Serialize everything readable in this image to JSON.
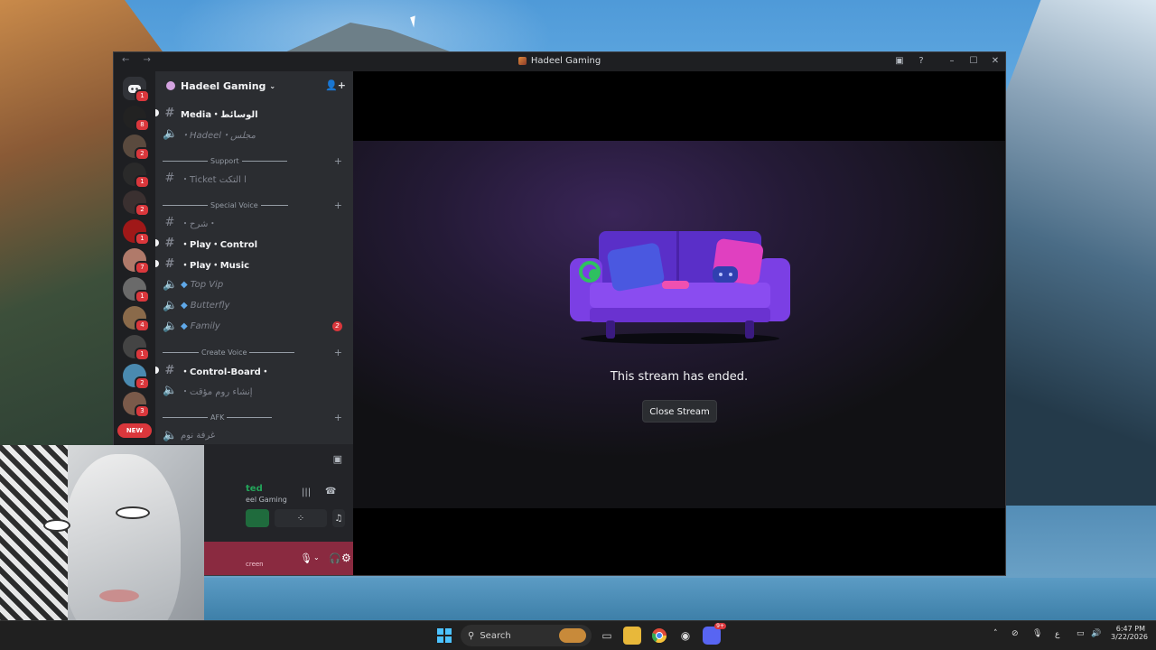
{
  "window": {
    "title": "Hadeel Gaming"
  },
  "server": {
    "name": "Hadeel Gaming"
  },
  "guilds": {
    "badges": [
      "1",
      "8",
      "2",
      "1",
      "2",
      "1",
      "7",
      "1",
      "4",
      "1",
      "2",
      "3"
    ],
    "new_label": "NEW"
  },
  "channels": {
    "media": "Media・الوسائط",
    "hadeel": "・Hadeel・مجلس",
    "cat_support": "Support",
    "ticket": "・Ticket ا التكت",
    "cat_special_voice": "Special Voice",
    "sharh": "・شرح・",
    "play_control": "・Play・Control",
    "play_music": "・Play・Music",
    "top_vip": "Top Vip",
    "butterfly": "Butterfly",
    "family": "Family",
    "family_badge": "2",
    "cat_create_voice": "Create Voice",
    "control_board": "・Control-Board・",
    "create_room": "・إنشاء روم مؤقت",
    "cat_afk": "AFK",
    "afk_room": "غرفة نوم"
  },
  "voice_panel": {
    "status": "ted",
    "server": "eel Gaming",
    "screen": "creen"
  },
  "stream": {
    "ended_text": "This stream has ended.",
    "close_label": "Close Stream"
  },
  "taskbar": {
    "search_placeholder": "Search",
    "ime": "ع",
    "time": "6:47 PM",
    "date": "3/22/2026",
    "discord_badge": "9+"
  },
  "colors": {
    "discord_blurple": "#5865f2",
    "mention_red": "#da373c",
    "connected_green": "#23a55a"
  }
}
